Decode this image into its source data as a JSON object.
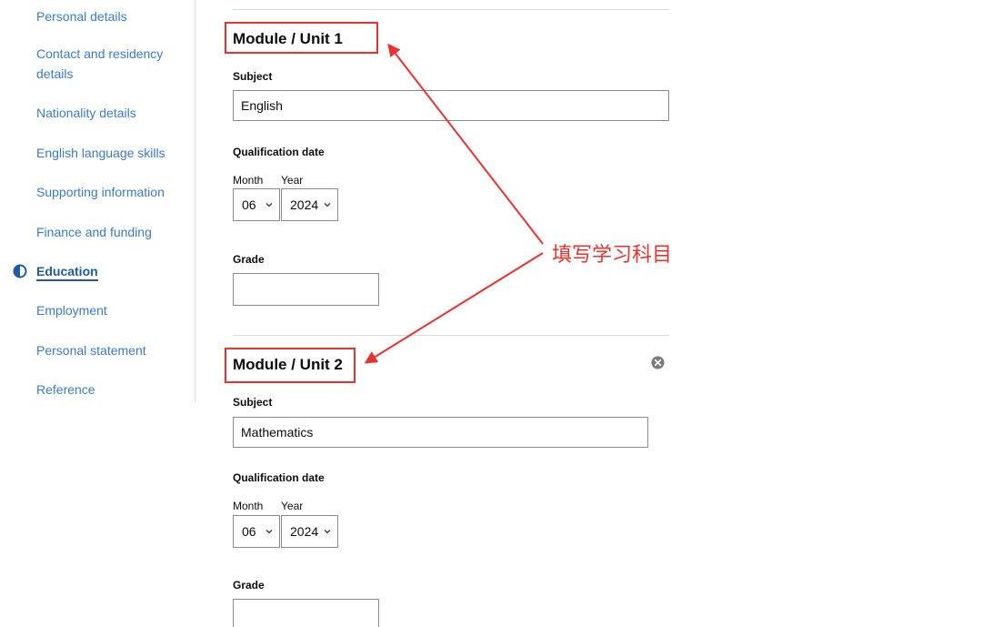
{
  "sidebar": {
    "items": [
      {
        "label": "Personal details"
      },
      {
        "label": "Contact and residency details"
      },
      {
        "label": "Nationality details"
      },
      {
        "label": "English language skills"
      },
      {
        "label": "Supporting information"
      },
      {
        "label": "Finance and funding"
      },
      {
        "label": "Education",
        "active": true
      },
      {
        "label": "Employment"
      },
      {
        "label": "Personal statement"
      },
      {
        "label": "Reference"
      }
    ]
  },
  "modules": [
    {
      "title": "Module / Unit 1",
      "subject_label": "Subject",
      "subject_value": "English",
      "qualification_date_label": "Qualification date",
      "month_label": "Month",
      "year_label": "Year",
      "month_value": "06",
      "year_value": "2024",
      "grade_label": "Grade",
      "grade_value": ""
    },
    {
      "title": "Module / Unit 2",
      "subject_label": "Subject",
      "subject_value": "Mathematics",
      "qualification_date_label": "Qualification date",
      "month_label": "Month",
      "year_label": "Year",
      "month_value": "06",
      "year_value": "2024",
      "grade_label": "Grade",
      "grade_value": ""
    }
  ],
  "annotation": {
    "text": "填写学习科目",
    "color": "#e8322f"
  },
  "colors": {
    "link": "#3a7bc8",
    "active": "#1f5aa8"
  },
  "icons": {
    "active_status": "half-circle-progress-icon",
    "remove": "close-circle-icon",
    "select": "chevron-down-icon"
  }
}
